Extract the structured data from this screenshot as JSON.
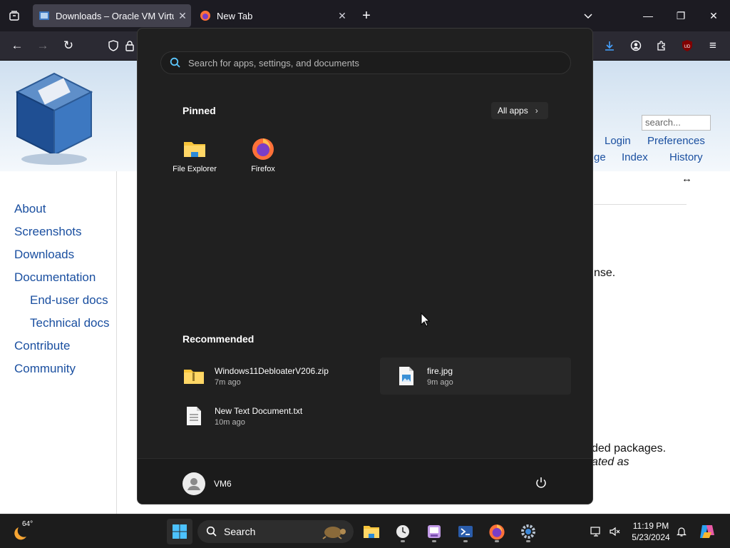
{
  "browser": {
    "tabs": [
      {
        "title": "Downloads – Oracle VM VirtualBox",
        "active": true
      },
      {
        "title": "New Tab",
        "active": false
      }
    ],
    "toolbar_icons": [
      "back-icon",
      "forward-icon",
      "reload-icon",
      "tracking-shield-icon",
      "lock-icon",
      "downloads-icon",
      "account-icon",
      "extensions-icon",
      "ublock-icon",
      "menu-icon"
    ],
    "ublock_badge": "UD"
  },
  "page": {
    "search_placeholder": "search...",
    "top_links": [
      "Login",
      "Preferences",
      "ge",
      "Index",
      "History"
    ],
    "side_links": [
      "About",
      "Screenshots",
      "Downloads",
      "Documentation",
      "End-user docs",
      "Technical docs",
      "Contribute",
      "Community"
    ],
    "fragments": [
      "nse.",
      "ded packages.",
      "ated as"
    ]
  },
  "start_menu": {
    "search_placeholder": "Search for apps, settings, and documents",
    "pinned_title": "Pinned",
    "all_apps_label": "All apps",
    "pinned": [
      {
        "name": "File Explorer",
        "icon": "folder-icon"
      },
      {
        "name": "Firefox",
        "icon": "firefox-icon"
      }
    ],
    "recommended_title": "Recommended",
    "recommended": [
      {
        "name": "Windows11DebloaterV206.zip",
        "time": "7m ago",
        "icon": "zip-folder-icon"
      },
      {
        "name": "fire.jpg",
        "time": "9m ago",
        "icon": "image-file-icon"
      },
      {
        "name": "New Text Document.txt",
        "time": "10m ago",
        "icon": "text-file-icon"
      }
    ],
    "user": "VM6"
  },
  "taskbar": {
    "weather_temp": "64°",
    "search_label": "Search",
    "time": "11:19 PM",
    "date": "5/23/2024",
    "pinned_icons": [
      "start-icon",
      "file-explorer-icon",
      "clock-app-icon",
      "notepad-app-icon",
      "powershell-icon",
      "firefox-icon",
      "settings-icon"
    ]
  }
}
